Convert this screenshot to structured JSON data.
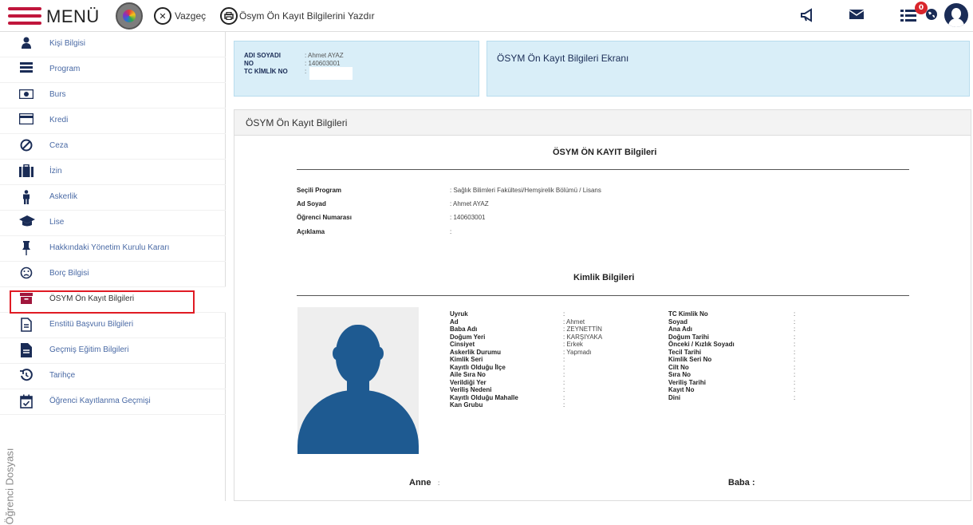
{
  "topbar": {
    "menu_label": "MENÜ",
    "cancel_label": "Vazgeç",
    "print_label": "Ösym Ön Kayıt Bilgilerini Yazdır",
    "notification_count": "0",
    "icons": [
      "megaphone-icon",
      "envelope-icon",
      "list-icon",
      "globe-icon",
      "user-avatar-icon"
    ]
  },
  "sidebar": {
    "items": [
      {
        "label": "Kişi Bilgisi",
        "icon": "person-icon"
      },
      {
        "label": "Program",
        "icon": "program-icon"
      },
      {
        "label": "Burs",
        "icon": "money-icon"
      },
      {
        "label": "Kredi",
        "icon": "credit-card-icon"
      },
      {
        "label": "Ceza",
        "icon": "ban-icon"
      },
      {
        "label": "İzin",
        "icon": "suitcase-icon"
      },
      {
        "label": "Askerlik",
        "icon": "soldier-icon"
      },
      {
        "label": "Lise",
        "icon": "graduation-cap-icon"
      },
      {
        "label": "Hakkındaki Yönetim Kurulu Kararı",
        "icon": "pin-icon"
      },
      {
        "label": "Borç Bilgisi",
        "icon": "sad-face-icon"
      },
      {
        "label": "ÖSYM Ön Kayıt Bilgileri",
        "icon": "archive-icon"
      },
      {
        "label": "Enstitü Başvuru Bilgileri",
        "icon": "document-icon"
      },
      {
        "label": "Geçmiş Eğitim Bilgileri",
        "icon": "file-icon"
      },
      {
        "label": "Tarihçe",
        "icon": "history-icon"
      },
      {
        "label": "Öğrenci Kayıtlanma Geçmişi",
        "icon": "calendar-check-icon"
      }
    ],
    "vertical_label": "Öğrenci Dosyası"
  },
  "student_box": {
    "name_label": "ADI SOYADI",
    "name_value": ": Ahmet AYAZ",
    "no_label": "NO",
    "no_value": ": 140603001",
    "tc_label": "TC KİMLİK NO",
    "tc_value": ":"
  },
  "screen_title": "ÖSYM Ön Kayıt Bilgileri Ekranı",
  "panel": {
    "title": "ÖSYM Ön Kayıt Bilgileri",
    "section1_title": "ÖSYM ÖN KAYIT Bilgileri",
    "section1_rows": [
      {
        "label": "Seçili Program",
        "value": ": Sağlık Bilimleri Fakültesi/Hemşirelik Bölümü / Lisans"
      },
      {
        "label": "Ad Soyad",
        "value": ": Ahmet AYAZ"
      },
      {
        "label": "Öğrenci Numarası",
        "value": ": 140603001"
      },
      {
        "label": "Açıklama",
        "value": ":"
      }
    ],
    "section2_title": "Kimlik Bilgileri",
    "left_rows": [
      {
        "label": "Uyruk",
        "value": ":"
      },
      {
        "label": "Ad",
        "value": ": Ahmet"
      },
      {
        "label": "Baba Adı",
        "value": ": ZEYNETTİN"
      },
      {
        "label": "Doğum Yeri",
        "value": ": KARŞIYAKA"
      },
      {
        "label": "Cinsiyet",
        "value": ": Erkek"
      },
      {
        "label": "Askerlik Durumu",
        "value": ": Yapmadı"
      },
      {
        "label": "Kimlik Seri",
        "value": ":"
      },
      {
        "label": "Kayıtlı Olduğu İlçe",
        "value": ":"
      },
      {
        "label": "Aile Sıra No",
        "value": ":"
      },
      {
        "label": "Verildiği Yer",
        "value": ":"
      },
      {
        "label": "Veriliş Nedeni",
        "value": ":"
      },
      {
        "label": "Kayıtlı Olduğu Mahalle",
        "value": ":"
      },
      {
        "label": "Kan Grubu",
        "value": ":"
      }
    ],
    "right_rows": [
      {
        "label": "TC Kimlik No",
        "value": ":"
      },
      {
        "label": "Soyad",
        "value": ":"
      },
      {
        "label": "Ana Adı",
        "value": ":"
      },
      {
        "label": "Doğum Tarihi",
        "value": ":"
      },
      {
        "label": "Önceki / Kızlık Soyadı",
        "value": ":"
      },
      {
        "label": "Tecil Tarihi",
        "value": ":"
      },
      {
        "label": "Kimlik Seri No",
        "value": ":"
      },
      {
        "label": "Cilt No",
        "value": ":"
      },
      {
        "label": "Sıra No",
        "value": ":"
      },
      {
        "label": "Veriliş Tarihi",
        "value": ":"
      },
      {
        "label": "Kayıt No",
        "value": ":"
      },
      {
        "label": "Dini",
        "value": ":"
      }
    ],
    "mother_label": "Anne",
    "mother_value": ":",
    "father_label": "Baba :"
  },
  "colors": {
    "accent": "#c0163c",
    "navy": "#1a2c56",
    "info_bg": "#d9eef8",
    "highlight": "#e01b24",
    "silhouette": "#1e5a91"
  }
}
